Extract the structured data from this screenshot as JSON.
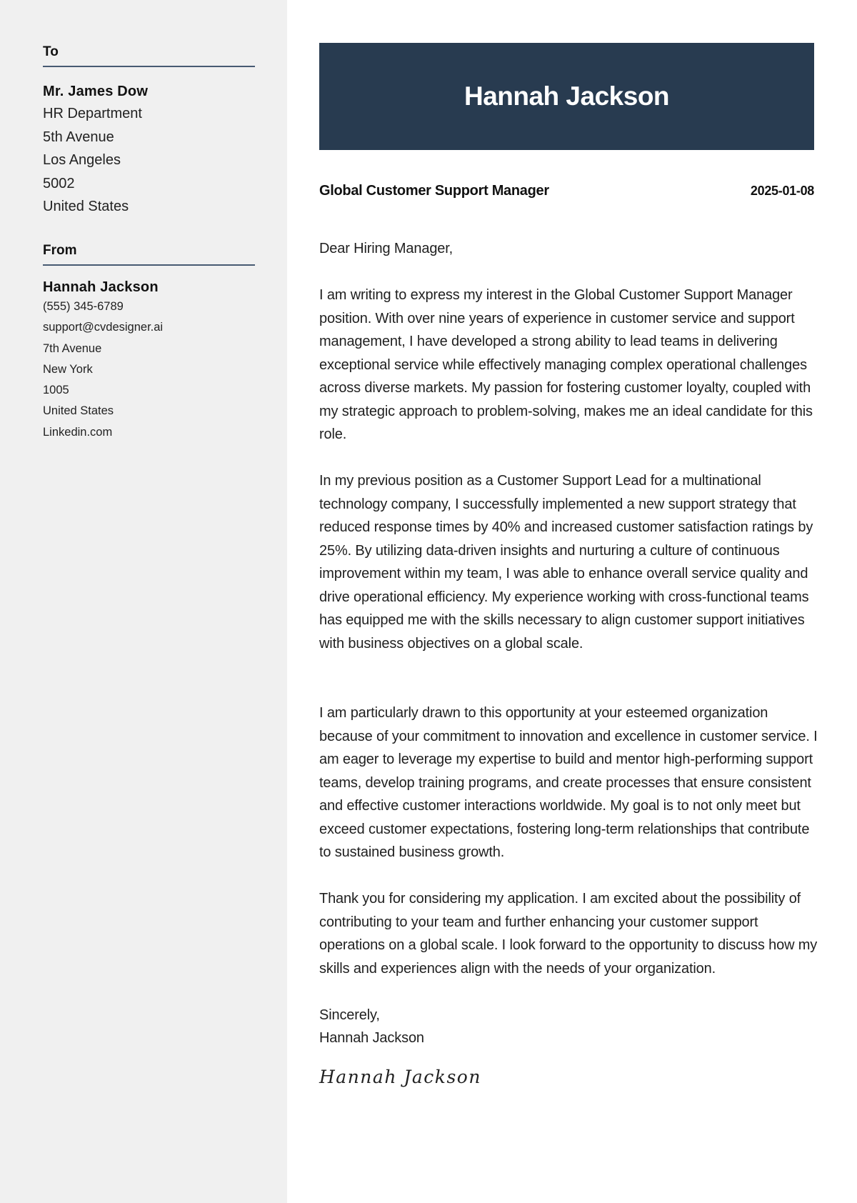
{
  "colors": {
    "sidebar_bg": "#f0f0f0",
    "header_bg": "#283b50",
    "rule": "#475a72",
    "text": "#1f1f1f"
  },
  "sidebar": {
    "to": {
      "heading": "To",
      "name": "Mr. James Dow",
      "lines": [
        "HR Department",
        "5th Avenue",
        "Los Angeles",
        "5002",
        "United States"
      ]
    },
    "from": {
      "heading": "From",
      "name": "Hannah Jackson",
      "phone": "(555) 345-6789",
      "email": "support@cvdesigner.ai",
      "street": "7th Avenue",
      "city": "New York",
      "zip": "1005",
      "country": "United States",
      "website": "Linkedin.com"
    }
  },
  "header": {
    "name": "Hannah Jackson"
  },
  "letter": {
    "job_title": "Global Customer Support Manager",
    "date": "2025-01-08",
    "salutation": "Dear Hiring Manager,",
    "paragraphs": [
      "I am writing to express my interest in the Global Customer Support Manager position. With over nine years of experience in customer service and support management, I have developed a strong ability to lead teams in delivering exceptional service while effectively managing complex operational challenges across diverse markets. My passion for fostering customer loyalty, coupled with my strategic approach to problem-solving, makes me an ideal candidate for this role.",
      "In my previous position as a Customer Support Lead for a multinational technology company, I successfully implemented a new support strategy that reduced response times by 40% and increased customer satisfaction ratings by 25%. By utilizing data-driven insights and nurturing a culture of continuous improvement within my team, I was able to enhance overall service quality and drive operational efficiency. My experience working with cross-functional teams has equipped me with the skills necessary to align customer support initiatives with business objectives on a global scale.",
      "I am particularly drawn to this opportunity at your esteemed organization because of your commitment to innovation and excellence in customer service. I am eager to leverage my expertise to build and mentor high-performing support teams, develop training programs, and create processes that ensure consistent and effective customer interactions worldwide. My goal is to not only meet but exceed customer expectations, fostering long-term relationships that contribute to sustained business growth.",
      "Thank you for considering my application. I am excited about the possibility of contributing to your team and further enhancing your customer support operations on a global scale. I look forward to the opportunity to discuss how my skills and experiences align with the needs of your organization."
    ],
    "closing": "Sincerely,",
    "closing_name": "Hannah Jackson",
    "signature": "Hannah Jackson"
  }
}
